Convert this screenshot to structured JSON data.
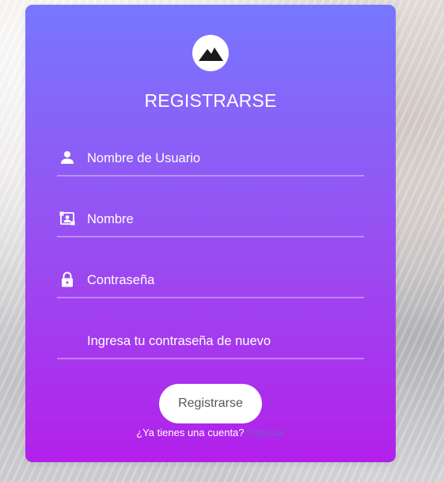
{
  "form": {
    "title": "REGISTRARSE",
    "fields": [
      {
        "icon": "user-icon",
        "placeholder": "Nombre de Usuario",
        "value": ""
      },
      {
        "icon": "id-card-icon",
        "placeholder": "Nombre",
        "value": ""
      },
      {
        "icon": "lock-icon",
        "placeholder": "Contraseña",
        "value": ""
      },
      {
        "icon": "",
        "placeholder": "Ingresa tu contraseña de nuevo",
        "value": ""
      }
    ],
    "submit_label": "Registrarse",
    "footer": {
      "question": "¿Ya tienes una cuenta?",
      "link": "Ingresar"
    }
  },
  "colors": {
    "gradient_top": "#7777ff",
    "gradient_bottom": "#b320ea",
    "button_bg": "#ffffff",
    "button_text": "#555555",
    "link_color": "#7d56c6"
  }
}
